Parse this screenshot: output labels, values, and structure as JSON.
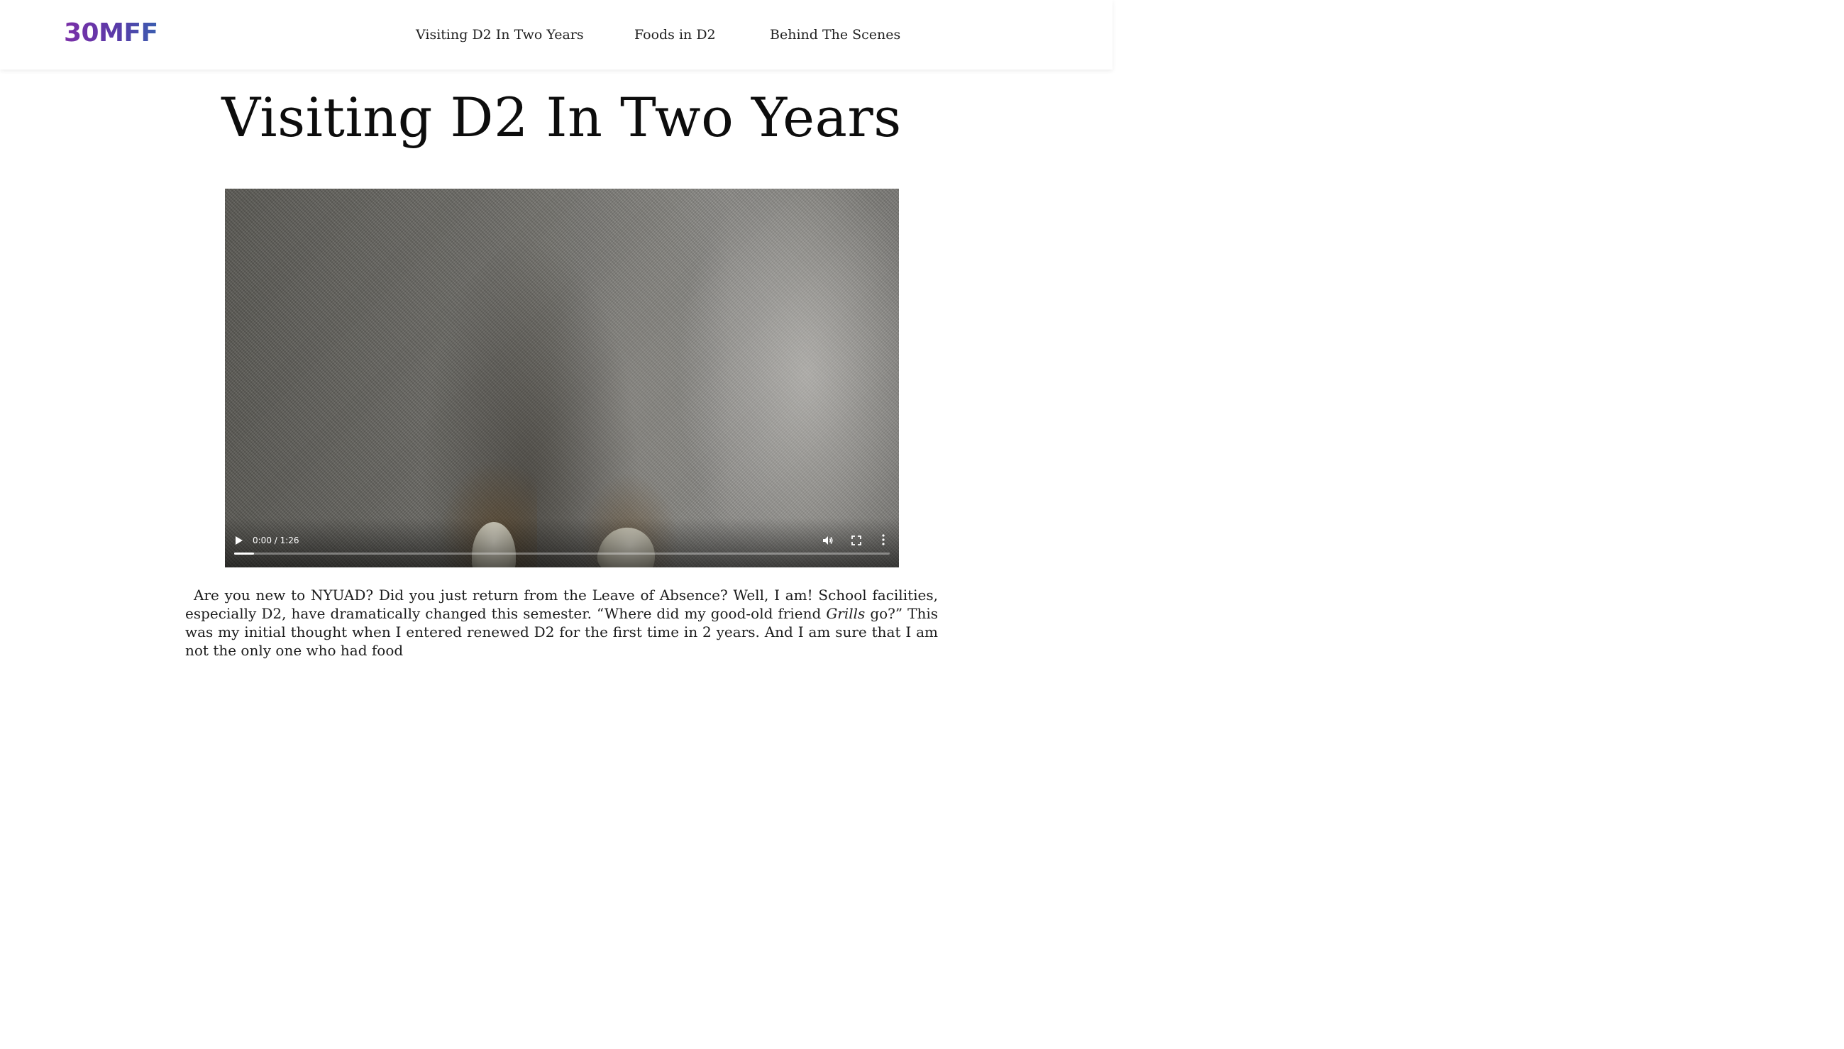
{
  "header": {
    "logo": "30MFF",
    "nav": [
      {
        "label": "Visiting D2 In Two Years"
      },
      {
        "label": "Foods in D2"
      },
      {
        "label": "Behind The Scenes"
      }
    ]
  },
  "main": {
    "title": "Visiting D2 In Two Years",
    "video": {
      "time": "0:00 / 1:26",
      "progress": 0.0,
      "icons": [
        "play-icon",
        "volume-icon",
        "fullscreen-icon",
        "more-options-icon"
      ]
    },
    "article": {
      "p1_part1": "Are you new to NYUAD? Did you just return from the Leave of Absence? Well, I am! School facilities, especially D2, have dramatically changed this semester. “Where did my good-old friend ",
      "p1_em": "Grills",
      "p1_part2": " go?” This was my initial thought when I entered renewed D2 for the first time in 2 years. And I am sure that I am not the only one who had food"
    }
  },
  "colors": {
    "logo_gradient_start": "#7b2fa8",
    "logo_gradient_end": "#3a5fb0",
    "text": "#1a1a1a",
    "background": "#ffffff"
  }
}
